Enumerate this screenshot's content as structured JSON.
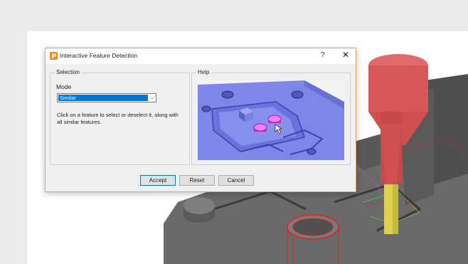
{
  "dialog": {
    "title": "Interactive Feature Detection",
    "help_symbol": "?",
    "close_symbol": "✕",
    "app_icon": "powermill-logo-icon"
  },
  "selection": {
    "group_label": "Selection",
    "mode_label": "Mode",
    "mode_value": "Similar",
    "instructions": "Click on a feature to select or deselect it, along with all similar features."
  },
  "help": {
    "group_label": "Help"
  },
  "buttons": {
    "accept": "Accept",
    "reset": "Reset",
    "cancel": "Cancel"
  },
  "colors": {
    "dialog_border": "#d8a56a",
    "selection_highlight": "#0078d7",
    "help_model": "#7e86e8",
    "feature_highlight": "#e040e0",
    "tool_tip": "#e05a5a",
    "tool_shank": "#e0d050"
  }
}
